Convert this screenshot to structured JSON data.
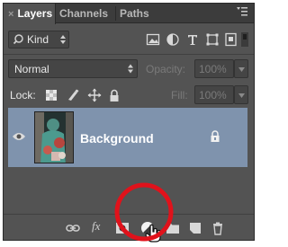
{
  "tabs": [
    {
      "label": "Layers",
      "close": "×",
      "active": true
    },
    {
      "label": "Channels",
      "active": false
    },
    {
      "label": "Paths",
      "active": false
    }
  ],
  "panel_menu_icon": "panel-menu-icon",
  "filter": {
    "label": "Kind",
    "icons": [
      "image-filter-icon",
      "adjustment-filter-icon",
      "type-filter-icon",
      "shape-filter-icon",
      "smart-object-filter-icon"
    ]
  },
  "blend": {
    "mode": "Normal",
    "opacity_label": "Opacity:",
    "opacity_value": "100%"
  },
  "lock": {
    "label": "Lock:",
    "fill_label": "Fill:",
    "fill_value": "100%"
  },
  "layer": {
    "name": "Background",
    "locked": true,
    "visible": true
  },
  "bottom_icons": [
    "link-icon",
    "fx-icon",
    "layer-mask-icon",
    "adjustment-layer-icon",
    "group-folder-icon",
    "new-layer-icon",
    "trash-icon"
  ],
  "colors": {
    "panel": "#535353",
    "selected_layer": "#7f93ad",
    "highlight_circle": "#e0121b"
  }
}
